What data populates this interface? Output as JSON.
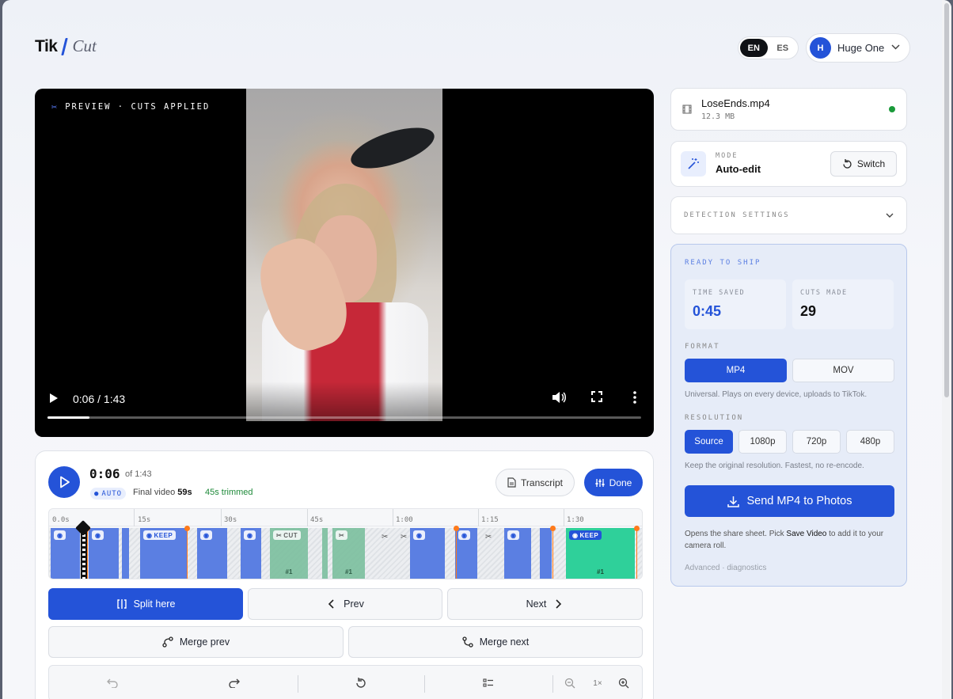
{
  "colors": {
    "accent": "#2453d8",
    "keep_segment": "#5b7fe2",
    "cut_segment": "#7cbf9e",
    "trim_marker": "#ff7a1a",
    "success": "#1f8a3a"
  },
  "header": {
    "logo_left": "Tik",
    "logo_right": "Cut",
    "languages": [
      "EN",
      "ES"
    ],
    "active_language": "EN",
    "user": {
      "initial": "H",
      "name": "Huge One"
    }
  },
  "player": {
    "label": "PREVIEW · CUTS APPLIED",
    "time_display": "0:06 / 1:43",
    "progress_fraction": 0.07
  },
  "editor": {
    "current_time": "0:06",
    "of_total": "of 1:43",
    "auto_badge": "AUTO",
    "final_video_label": "Final video",
    "final_video_value": "59s",
    "trimmed": "45s trimmed",
    "transcript_label": "Transcript",
    "done_label": "Done",
    "ruler_ticks": [
      "0.0s",
      "15s",
      "30s",
      "45s",
      "1:00",
      "1:15",
      "1:30"
    ],
    "chips": {
      "keep": "KEEP",
      "cut": "CUT",
      "seg_number": "#1"
    },
    "split_label": "Split here",
    "prev_label": "Prev",
    "next_label": "Next",
    "merge_prev_label": "Merge prev",
    "merge_next_label": "Merge next",
    "zoom_label": "1×"
  },
  "file": {
    "name": "LoseEnds.mp4",
    "size": "12.3 MB"
  },
  "mode": {
    "label": "MODE",
    "value": "Auto-edit",
    "switch_label": "Switch"
  },
  "detection": {
    "label": "DETECTION SETTINGS"
  },
  "ship": {
    "title": "READY TO SHIP",
    "time_saved_label": "TIME SAVED",
    "time_saved_value": "0:45",
    "cuts_made_label": "CUTS MADE",
    "cuts_made_value": "29",
    "format_label": "FORMAT",
    "formats": [
      "MP4",
      "MOV"
    ],
    "selected_format": "MP4",
    "format_hint": "Universal. Plays on every device, uploads to TikTok.",
    "resolution_label": "RESOLUTION",
    "resolutions": [
      "Source",
      "1080p",
      "720p",
      "480p"
    ],
    "selected_resolution": "Source",
    "resolution_hint": "Keep the original resolution. Fastest, no re-encode.",
    "send_label": "Send MP4 to Photos",
    "opens_before": "Opens the share sheet. Pick",
    "opens_bold": "Save Video",
    "opens_after": "to add it to your camera roll.",
    "advanced": "Advanced · diagnostics"
  }
}
